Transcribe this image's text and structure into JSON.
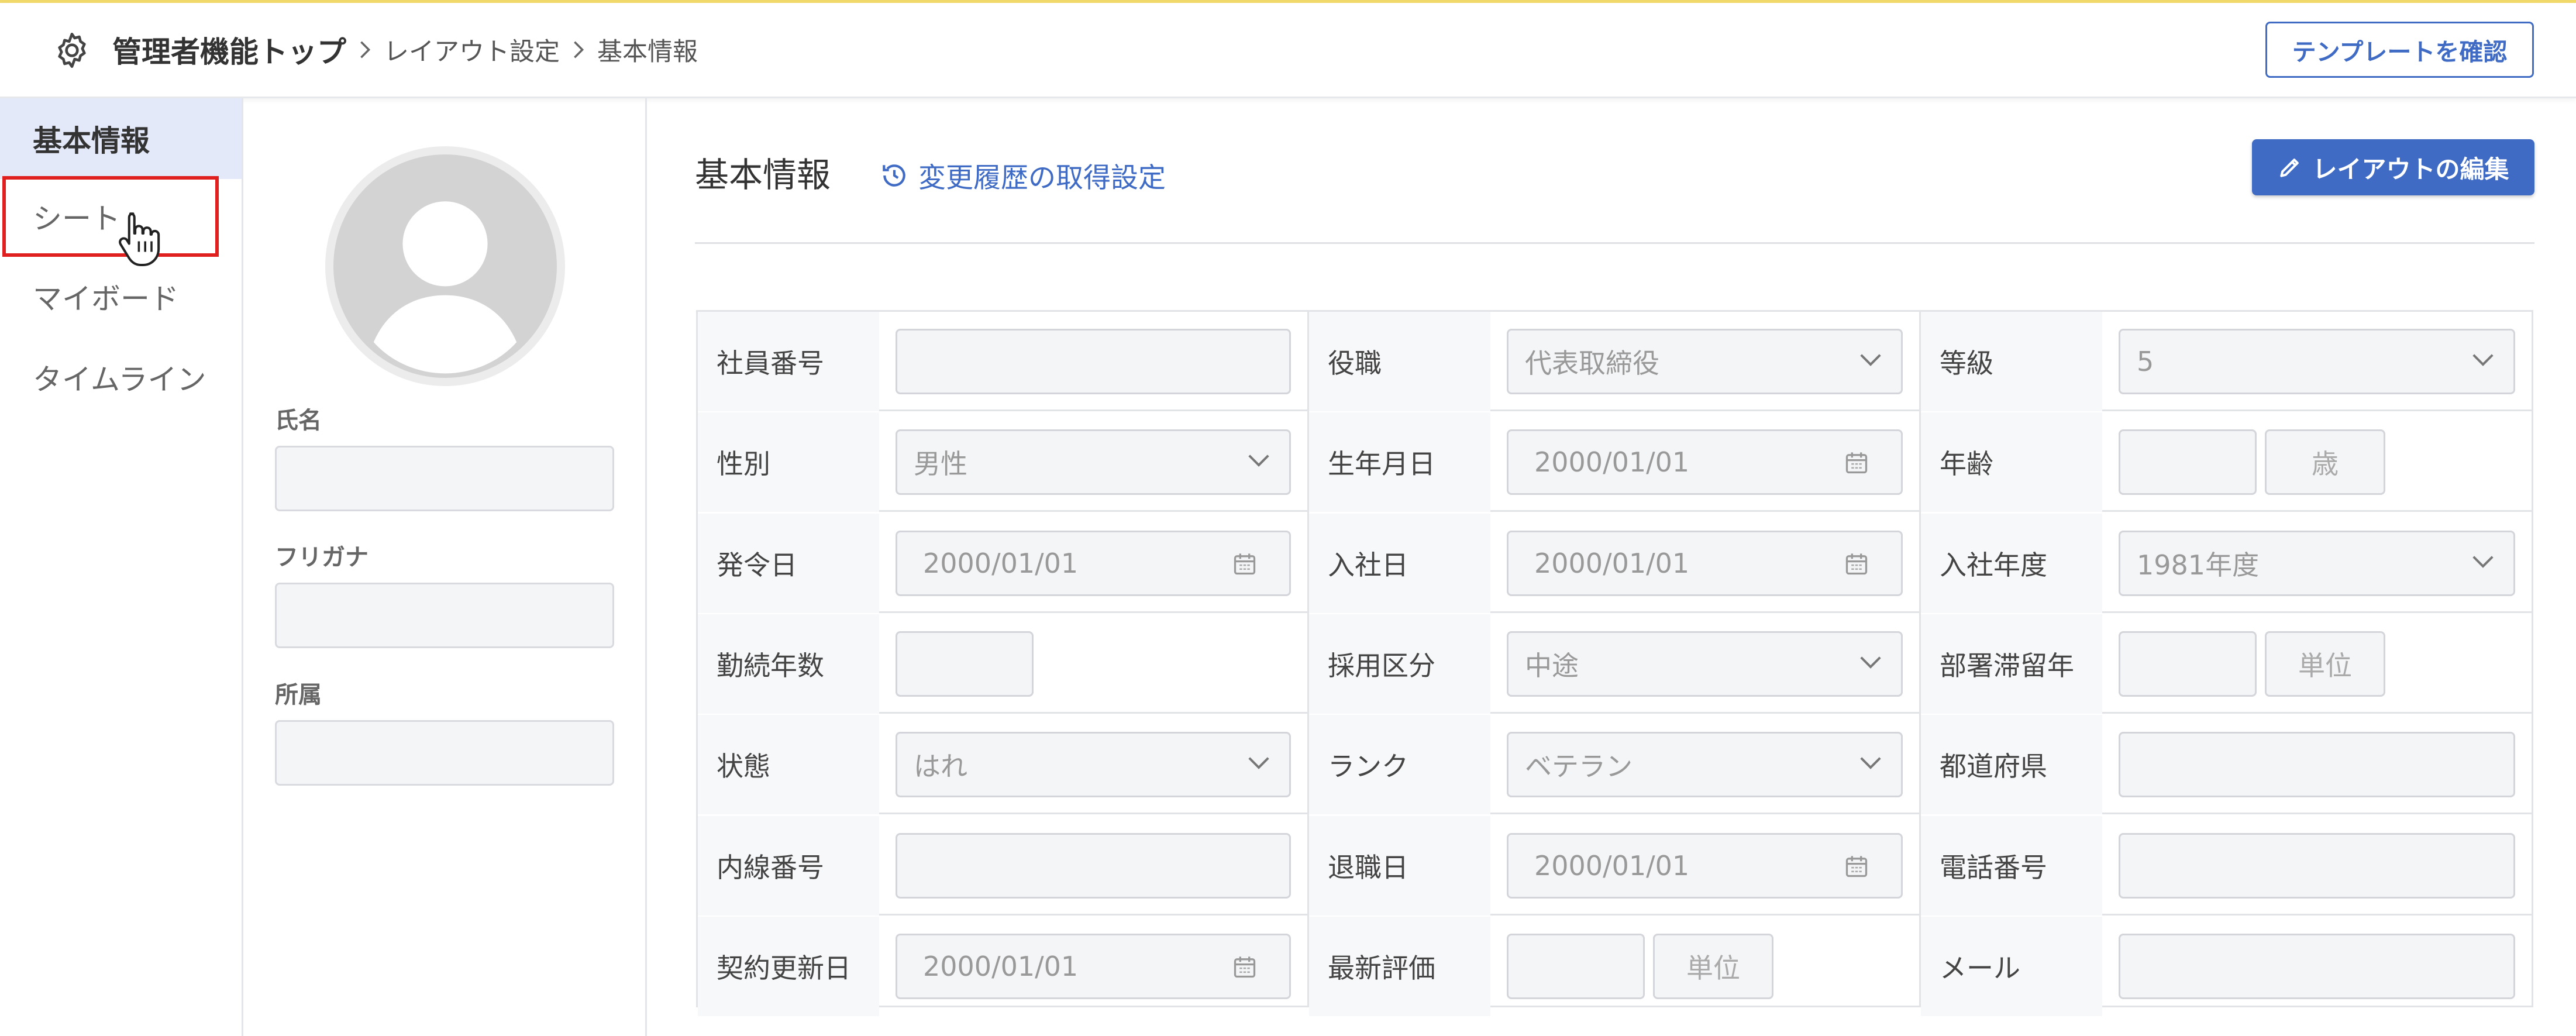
{
  "header": {
    "breadcrumb": [
      "管理者機能トップ",
      "レイアウト設定",
      "基本情報"
    ],
    "template_button": "テンプレートを確認"
  },
  "sidebar": {
    "items": [
      {
        "label": "基本情報",
        "active": true
      },
      {
        "label": "シート",
        "active": false,
        "highlighted": true
      },
      {
        "label": "マイボード",
        "active": false
      },
      {
        "label": "タイムライン",
        "active": false
      }
    ]
  },
  "profile": {
    "fields": [
      {
        "label": "氏名",
        "value": ""
      },
      {
        "label": "フリガナ",
        "value": ""
      },
      {
        "label": "所属",
        "value": ""
      }
    ]
  },
  "main": {
    "title": "基本情報",
    "history_link": "変更履歴の取得設定",
    "edit_button": "レイアウトの編集",
    "rows": [
      [
        {
          "label": "社員番号",
          "type": "text",
          "value": ""
        },
        {
          "label": "役職",
          "type": "select",
          "value": "代表取締役"
        },
        {
          "label": "等級",
          "type": "select",
          "value": "5"
        }
      ],
      [
        {
          "label": "性別",
          "type": "select",
          "value": "男性"
        },
        {
          "label": "生年月日",
          "type": "date",
          "value": "2000/01/01"
        },
        {
          "label": "年齢",
          "type": "unit",
          "value": "",
          "unit": "歳"
        }
      ],
      [
        {
          "label": "発令日",
          "type": "date",
          "value": "2000/01/01"
        },
        {
          "label": "入社日",
          "type": "date",
          "value": "2000/01/01"
        },
        {
          "label": "入社年度",
          "type": "select",
          "value": "1981年度"
        }
      ],
      [
        {
          "label": "勤続年数",
          "type": "short",
          "value": ""
        },
        {
          "label": "採用区分",
          "type": "select",
          "value": "中途"
        },
        {
          "label": "部署滞留年",
          "type": "unit",
          "value": "",
          "unit": "単位"
        }
      ],
      [
        {
          "label": "状態",
          "type": "select",
          "value": "はれ"
        },
        {
          "label": "ランク",
          "type": "select",
          "value": "ベテラン"
        },
        {
          "label": "都道府県",
          "type": "text",
          "value": ""
        }
      ],
      [
        {
          "label": "内線番号",
          "type": "text",
          "value": ""
        },
        {
          "label": "退職日",
          "type": "date",
          "value": "2000/01/01"
        },
        {
          "label": "電話番号",
          "type": "text",
          "value": ""
        }
      ],
      [
        {
          "label": "契約更新日",
          "type": "date",
          "value": "2000/01/01"
        },
        {
          "label": "最新評価",
          "type": "unit",
          "value": "",
          "unit": "単位"
        },
        {
          "label": "メール",
          "type": "text",
          "value": ""
        }
      ]
    ]
  },
  "colors": {
    "accent": "#3f6bc4",
    "highlight_box": "#e01f1f",
    "sidebar_active": "#e3e9f8"
  }
}
